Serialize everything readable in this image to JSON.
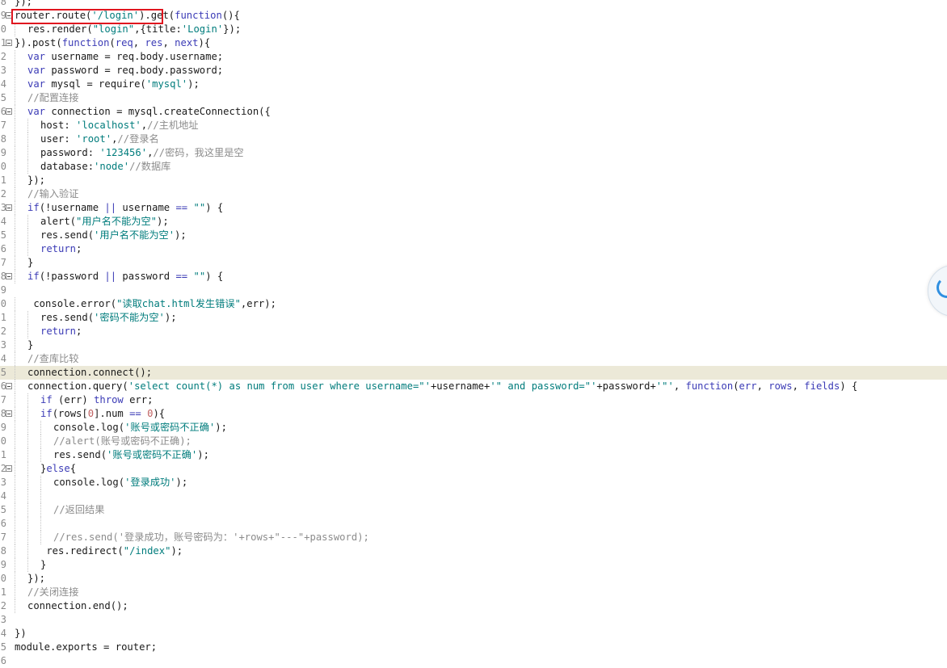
{
  "editor": {
    "current_line": "5",
    "lines": [
      {
        "n": "8",
        "fold": false,
        "indent": 0,
        "tokens": [
          [
            "d",
            "});"
          ]
        ]
      },
      {
        "n": "9",
        "fold": true,
        "indent": 0,
        "tokens": [
          [
            "d",
            "router.route("
          ],
          [
            "s",
            "'/login'"
          ],
          [
            "d",
            ").get("
          ],
          [
            "k",
            "function"
          ],
          [
            "d",
            "(){"
          ]
        ]
      },
      {
        "n": "0",
        "fold": false,
        "indent": 1,
        "tokens": [
          [
            "d",
            "res.render("
          ],
          [
            "s",
            "\"login\""
          ],
          [
            "d",
            ",{title:"
          ],
          [
            "s",
            "'Login'"
          ],
          [
            "d",
            "});"
          ]
        ]
      },
      {
        "n": "1",
        "fold": true,
        "indent": 0,
        "tokens": [
          [
            "d",
            "}).post("
          ],
          [
            "k",
            "function"
          ],
          [
            "d",
            "("
          ],
          [
            "k",
            "req"
          ],
          [
            "d",
            ", "
          ],
          [
            "k",
            "res"
          ],
          [
            "d",
            ", "
          ],
          [
            "k",
            "next"
          ],
          [
            "d",
            "){"
          ]
        ]
      },
      {
        "n": "2",
        "fold": false,
        "indent": 1,
        "tokens": [
          [
            "k",
            "var"
          ],
          [
            "d",
            " username = req.body.username;"
          ]
        ]
      },
      {
        "n": "3",
        "fold": false,
        "indent": 1,
        "tokens": [
          [
            "k",
            "var"
          ],
          [
            "d",
            " password = req.body.password;"
          ]
        ]
      },
      {
        "n": "4",
        "fold": false,
        "indent": 1,
        "tokens": [
          [
            "k",
            "var"
          ],
          [
            "d",
            " mysql = require("
          ],
          [
            "s",
            "'mysql'"
          ],
          [
            "d",
            ");"
          ]
        ]
      },
      {
        "n": "5",
        "fold": false,
        "indent": 1,
        "tokens": [
          [
            "c",
            "//配置连接"
          ]
        ]
      },
      {
        "n": "6",
        "fold": true,
        "indent": 1,
        "tokens": [
          [
            "k",
            "var"
          ],
          [
            "d",
            " connection = mysql.createConnection({"
          ]
        ]
      },
      {
        "n": "7",
        "fold": false,
        "indent": 2,
        "tokens": [
          [
            "d",
            "host: "
          ],
          [
            "s",
            "'localhost'"
          ],
          [
            "d",
            ","
          ],
          [
            "c",
            "//主机地址"
          ]
        ]
      },
      {
        "n": "8",
        "fold": false,
        "indent": 2,
        "tokens": [
          [
            "d",
            "user: "
          ],
          [
            "s",
            "'root'"
          ],
          [
            "d",
            ","
          ],
          [
            "c",
            "//登录名"
          ]
        ]
      },
      {
        "n": "9",
        "fold": false,
        "indent": 2,
        "tokens": [
          [
            "d",
            "password: "
          ],
          [
            "s",
            "'123456'"
          ],
          [
            "d",
            ","
          ],
          [
            "c",
            "//密码，我这里是空"
          ]
        ]
      },
      {
        "n": "0",
        "fold": false,
        "indent": 2,
        "tokens": [
          [
            "d",
            "database:"
          ],
          [
            "s",
            "'node'"
          ],
          [
            "c",
            "//数据库"
          ]
        ]
      },
      {
        "n": "1",
        "fold": false,
        "indent": 1,
        "tokens": [
          [
            "d",
            "});"
          ]
        ]
      },
      {
        "n": "2",
        "fold": false,
        "indent": 1,
        "tokens": [
          [
            "c",
            "//输入验证"
          ]
        ]
      },
      {
        "n": "3",
        "fold": true,
        "indent": 1,
        "tokens": [
          [
            "k",
            "if"
          ],
          [
            "d",
            "(!username "
          ],
          [
            "k",
            "||"
          ],
          [
            "d",
            " username "
          ],
          [
            "k",
            "=="
          ],
          [
            "d",
            " "
          ],
          [
            "s",
            "\"\""
          ],
          [
            "d",
            ") {"
          ]
        ]
      },
      {
        "n": "4",
        "fold": false,
        "indent": 2,
        "tokens": [
          [
            "d",
            "alert("
          ],
          [
            "s",
            "\"用户名不能为空\""
          ],
          [
            "d",
            ");"
          ]
        ]
      },
      {
        "n": "5",
        "fold": false,
        "indent": 2,
        "tokens": [
          [
            "d",
            "res.send("
          ],
          [
            "s",
            "'用户名不能为空'"
          ],
          [
            "d",
            ");"
          ]
        ]
      },
      {
        "n": "6",
        "fold": false,
        "indent": 2,
        "tokens": [
          [
            "k",
            "return"
          ],
          [
            "d",
            ";"
          ]
        ]
      },
      {
        "n": "7",
        "fold": false,
        "indent": 1,
        "tokens": [
          [
            "d",
            "}"
          ]
        ]
      },
      {
        "n": "8",
        "fold": true,
        "indent": 1,
        "tokens": [
          [
            "k",
            "if"
          ],
          [
            "d",
            "(!password "
          ],
          [
            "k",
            "||"
          ],
          [
            "d",
            " password "
          ],
          [
            "k",
            "=="
          ],
          [
            "d",
            " "
          ],
          [
            "s",
            "\"\""
          ],
          [
            "d",
            ") {"
          ]
        ]
      },
      {
        "n": "9",
        "fold": false,
        "indent": 0,
        "tokens": []
      },
      {
        "n": "0",
        "fold": false,
        "indent": 1,
        "lead": " ",
        "tokens": [
          [
            "d",
            "console.error("
          ],
          [
            "s",
            "\"读取chat.html发生错误\""
          ],
          [
            "d",
            ",err);"
          ]
        ]
      },
      {
        "n": "1",
        "fold": false,
        "indent": 2,
        "tokens": [
          [
            "d",
            "res.send("
          ],
          [
            "s",
            "'密码不能为空'"
          ],
          [
            "d",
            ");"
          ]
        ]
      },
      {
        "n": "2",
        "fold": false,
        "indent": 2,
        "tokens": [
          [
            "k",
            "return"
          ],
          [
            "d",
            ";"
          ]
        ]
      },
      {
        "n": "3",
        "fold": false,
        "indent": 1,
        "tokens": [
          [
            "d",
            "}"
          ]
        ]
      },
      {
        "n": "4",
        "fold": false,
        "indent": 1,
        "tokens": [
          [
            "c",
            "//查库比较"
          ]
        ]
      },
      {
        "n": "5",
        "fold": false,
        "indent": 1,
        "tokens": [
          [
            "d",
            "connection.connect();"
          ]
        ]
      },
      {
        "n": "6",
        "fold": true,
        "indent": 1,
        "tokens": [
          [
            "d",
            "connection.query("
          ],
          [
            "s",
            "'select count(*) as num from user where username=\"'"
          ],
          [
            "d",
            "+username+"
          ],
          [
            "s",
            "'\" and password=\"'"
          ],
          [
            "d",
            "+password+"
          ],
          [
            "s",
            "'\"'"
          ],
          [
            "d",
            ", "
          ],
          [
            "k",
            "function"
          ],
          [
            "d",
            "("
          ],
          [
            "k",
            "err"
          ],
          [
            "d",
            ", "
          ],
          [
            "k",
            "rows"
          ],
          [
            "d",
            ", "
          ],
          [
            "k",
            "fields"
          ],
          [
            "d",
            ") {"
          ]
        ]
      },
      {
        "n": "7",
        "fold": false,
        "indent": 2,
        "tokens": [
          [
            "k",
            "if"
          ],
          [
            "d",
            " (err) "
          ],
          [
            "k",
            "throw"
          ],
          [
            "d",
            " err;"
          ]
        ]
      },
      {
        "n": "8",
        "fold": true,
        "indent": 2,
        "tokens": [
          [
            "k",
            "if"
          ],
          [
            "d",
            "(rows["
          ],
          [
            "n",
            "0"
          ],
          [
            "d",
            "].num "
          ],
          [
            "k",
            "=="
          ],
          [
            "d",
            " "
          ],
          [
            "n",
            "0"
          ],
          [
            "d",
            "){"
          ]
        ]
      },
      {
        "n": "9",
        "fold": false,
        "indent": 3,
        "tokens": [
          [
            "d",
            "console.log("
          ],
          [
            "s",
            "'账号或密码不正确'"
          ],
          [
            "d",
            ");"
          ]
        ]
      },
      {
        "n": "0",
        "fold": false,
        "indent": 3,
        "tokens": [
          [
            "c",
            "//alert(账号或密码不正确);"
          ]
        ]
      },
      {
        "n": "1",
        "fold": false,
        "indent": 3,
        "tokens": [
          [
            "d",
            "res.send("
          ],
          [
            "s",
            "'账号或密码不正确'"
          ],
          [
            "d",
            ");"
          ]
        ]
      },
      {
        "n": "2",
        "fold": true,
        "indent": 2,
        "tokens": [
          [
            "d",
            "}"
          ],
          [
            "k",
            "else"
          ],
          [
            "d",
            "{"
          ]
        ]
      },
      {
        "n": "3",
        "fold": false,
        "indent": 3,
        "tokens": [
          [
            "d",
            "console.log("
          ],
          [
            "s",
            "'登录成功'"
          ],
          [
            "d",
            ");"
          ]
        ]
      },
      {
        "n": "4",
        "fold": false,
        "indent": 3,
        "tokens": []
      },
      {
        "n": "5",
        "fold": false,
        "indent": 3,
        "tokens": [
          [
            "c",
            "//返回结果"
          ]
        ]
      },
      {
        "n": "6",
        "fold": false,
        "indent": 3,
        "tokens": []
      },
      {
        "n": "7",
        "fold": false,
        "indent": 3,
        "tokens": [
          [
            "c",
            "//res.send('登录成功，账号密码为：'+rows+\"---\"+password);"
          ]
        ]
      },
      {
        "n": "8",
        "fold": false,
        "indent": 2,
        "lead": " ",
        "tokens": [
          [
            "d",
            "res.redirect("
          ],
          [
            "s",
            "\"/index\""
          ],
          [
            "d",
            ");"
          ]
        ]
      },
      {
        "n": "9",
        "fold": false,
        "indent": 2,
        "tokens": [
          [
            "d",
            "}"
          ]
        ]
      },
      {
        "n": "0",
        "fold": false,
        "indent": 1,
        "tokens": [
          [
            "d",
            "});"
          ]
        ]
      },
      {
        "n": "1",
        "fold": false,
        "indent": 1,
        "tokens": [
          [
            "c",
            "//关闭连接"
          ]
        ]
      },
      {
        "n": "2",
        "fold": false,
        "indent": 1,
        "tokens": [
          [
            "d",
            "connection.end();"
          ]
        ]
      },
      {
        "n": "3",
        "fold": false,
        "indent": 0,
        "tokens": []
      },
      {
        "n": "4",
        "fold": false,
        "indent": 0,
        "tokens": [
          [
            "d",
            "})"
          ]
        ]
      },
      {
        "n": "5",
        "fold": false,
        "indent": 0,
        "tokens": [
          [
            "d",
            "module.exports = router;"
          ]
        ]
      },
      {
        "n": "6",
        "fold": false,
        "indent": 0,
        "tokens": []
      }
    ]
  },
  "overlay": {
    "highlight_color": "#e0161f",
    "side_bubble_icon": "floating-assistant-icon"
  }
}
